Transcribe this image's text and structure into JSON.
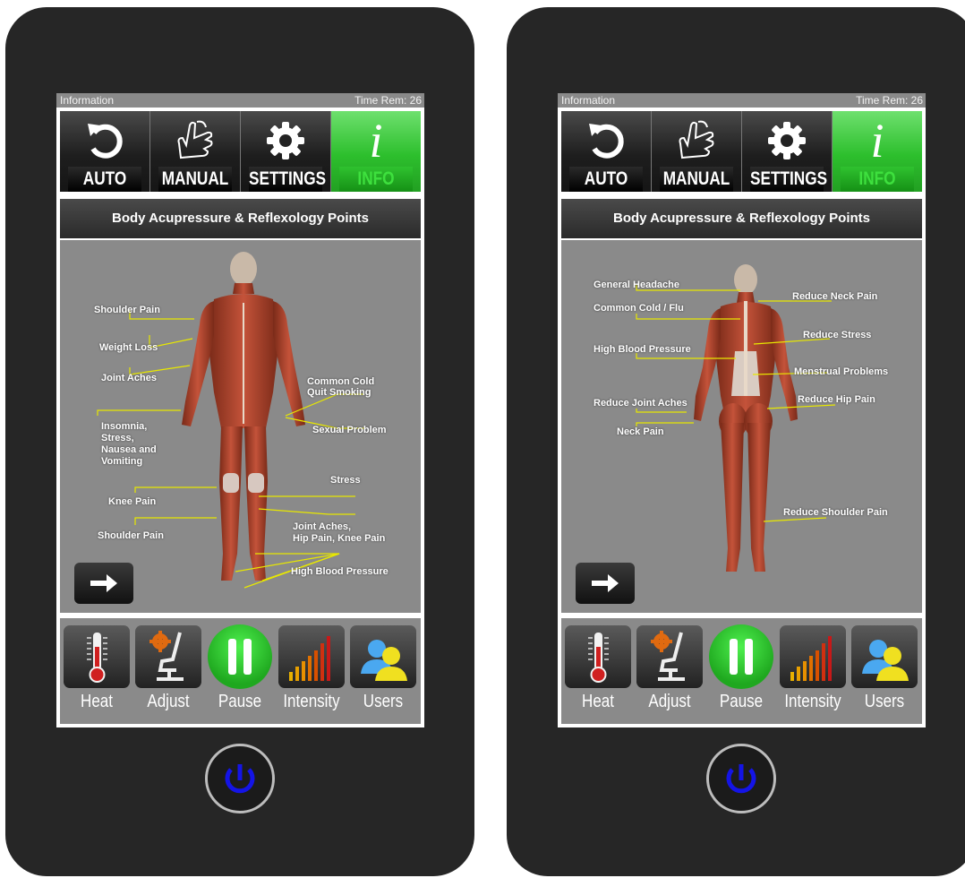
{
  "status": {
    "left": "Information",
    "right": "Time Rem: 26"
  },
  "tabs": [
    {
      "label": "AUTO",
      "icon": "refresh-icon"
    },
    {
      "label": "MANUAL",
      "icon": "hand-icon"
    },
    {
      "label": "SETTINGS",
      "icon": "gear-icon"
    },
    {
      "label": "INFO",
      "icon": "info-icon",
      "active": true
    }
  ],
  "header": "Body Acupressure & Reflexology Points",
  "info_glyph": "i",
  "front_labels": [
    "Shoulder Pain",
    "Weight Loss",
    "Joint Aches",
    "Common Cold",
    "Quit Smoking",
    "Insomnia,",
    "Stress,",
    "Nausea and",
    "Vomiting",
    "Sexual Problem",
    "Stress",
    "Knee Pain",
    "Joint Aches,",
    "Hip Pain, Knee Pain",
    "Shoulder Pain",
    "High Blood Pressure"
  ],
  "back_labels": [
    "General Headache",
    "Reduce Neck Pain",
    "Common Cold / Flu",
    "Reduce Stress",
    "High Blood Pressure",
    "Menstrual Problems",
    "Reduce Hip Pain",
    "Reduce Joint Aches",
    "Neck Pain",
    "Reduce Shoulder Pain"
  ],
  "toolbar": [
    {
      "label": "Heat",
      "icon": "thermometer-icon"
    },
    {
      "label": "Adjust",
      "icon": "chair-gear-icon"
    },
    {
      "label": "Pause",
      "icon": "pause-icon"
    },
    {
      "label": "Intensity",
      "icon": "intensity-bars-icon"
    },
    {
      "label": "Users",
      "icon": "users-icon"
    }
  ],
  "colors": {
    "accent_green": "#2dbf2d",
    "label_green": "#3ee03e",
    "leader_yellow": "#e8e800",
    "power_blue": "#1414e6",
    "device": "#262626",
    "panel_gray": "#8a8a8a"
  }
}
